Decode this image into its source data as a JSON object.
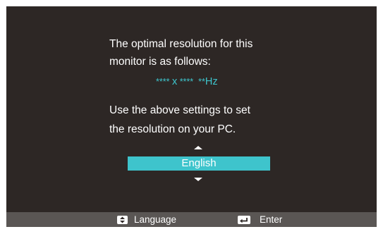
{
  "osd": {
    "message": {
      "line1": "The optimal resolution for this",
      "line2": " monitor is as follows:",
      "resolution_width": "****",
      "resolution_x": "x",
      "resolution_height": "****",
      "refresh_rate_stars": "**",
      "refresh_rate_unit": "Hz",
      "line3": "Use the above settings to set",
      "line4": "the resolution on your PC."
    },
    "language_selector": {
      "selected": "English"
    },
    "footer": {
      "language_hint": "Language",
      "enter_hint": "Enter"
    },
    "colors": {
      "background": "#2d2725",
      "accent": "#3ec4cc",
      "footer": "#5a5654"
    },
    "icons": {
      "up_arrow": "triangle-up-icon",
      "down_arrow": "triangle-down-icon",
      "language_key": "up-down-key-icon",
      "enter_key": "enter-key-icon"
    }
  }
}
